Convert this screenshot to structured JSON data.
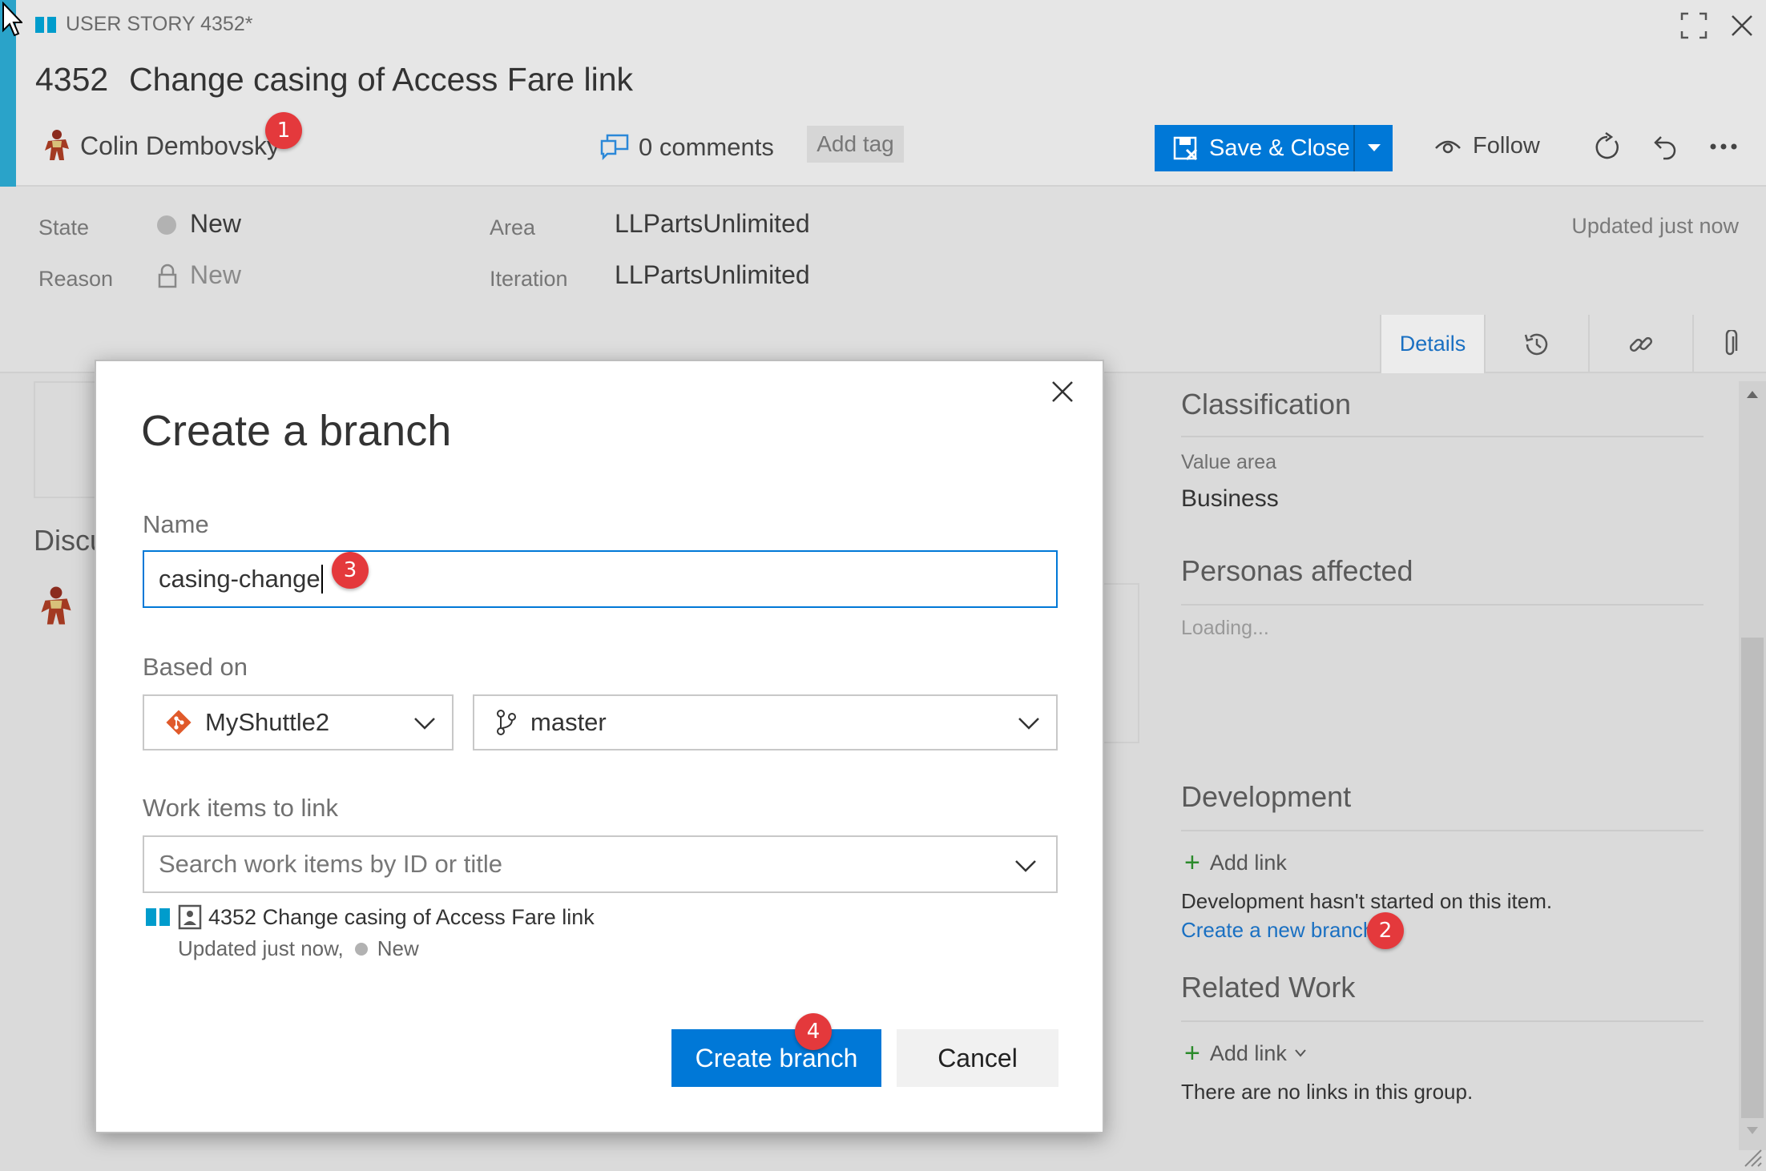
{
  "header": {
    "item_type": "USER STORY 4352*",
    "item_id": "4352",
    "title": "Change casing of Access Fare link",
    "assignee": "Colin Dembovsky",
    "comments": "0 comments",
    "add_tag": "Add tag",
    "save_close": "Save & Close",
    "follow": "Follow"
  },
  "fields": {
    "state_label": "State",
    "state_value": "New",
    "reason_label": "Reason",
    "reason_value": "New",
    "area_label": "Area",
    "area_value": "LLPartsUnlimited",
    "iteration_label": "Iteration",
    "iteration_value": "LLPartsUnlimited",
    "updated": "Updated just now"
  },
  "tabs": {
    "details": "Details"
  },
  "left_panel": {
    "discussion_partial": "Discu"
  },
  "right_panel": {
    "classification_title": "Classification",
    "value_area_label": "Value area",
    "value_area_value": "Business",
    "personas_title": "Personas affected",
    "loading": "Loading...",
    "development_title": "Development",
    "dev_add_link": "Add link",
    "dev_message": "Development hasn't started on this item.",
    "create_branch_link": "Create a new branch",
    "related_title": "Related Work",
    "related_add_link": "Add link",
    "related_message": "There are no links in this group."
  },
  "dialog": {
    "title": "Create a branch",
    "name_label": "Name",
    "name_value": "casing-change",
    "based_on_label": "Based on",
    "repo_value": "MyShuttle2",
    "branch_value": "master",
    "work_items_label": "Work items to link",
    "search_placeholder": "Search work items by ID or title",
    "linked_item_title": "4352 Change casing of Access Fare link",
    "linked_item_meta": "Updated just now,",
    "linked_item_state": "New",
    "create_button": "Create branch",
    "cancel_button": "Cancel"
  },
  "badges": {
    "b1": "1",
    "b2": "2",
    "b3": "3",
    "b4": "4"
  },
  "colors": {
    "accent": "#2aa3c9",
    "primary": "#0078d7",
    "link": "#1a70c2",
    "badge": "#e4393c",
    "git": "#e05a2b"
  }
}
